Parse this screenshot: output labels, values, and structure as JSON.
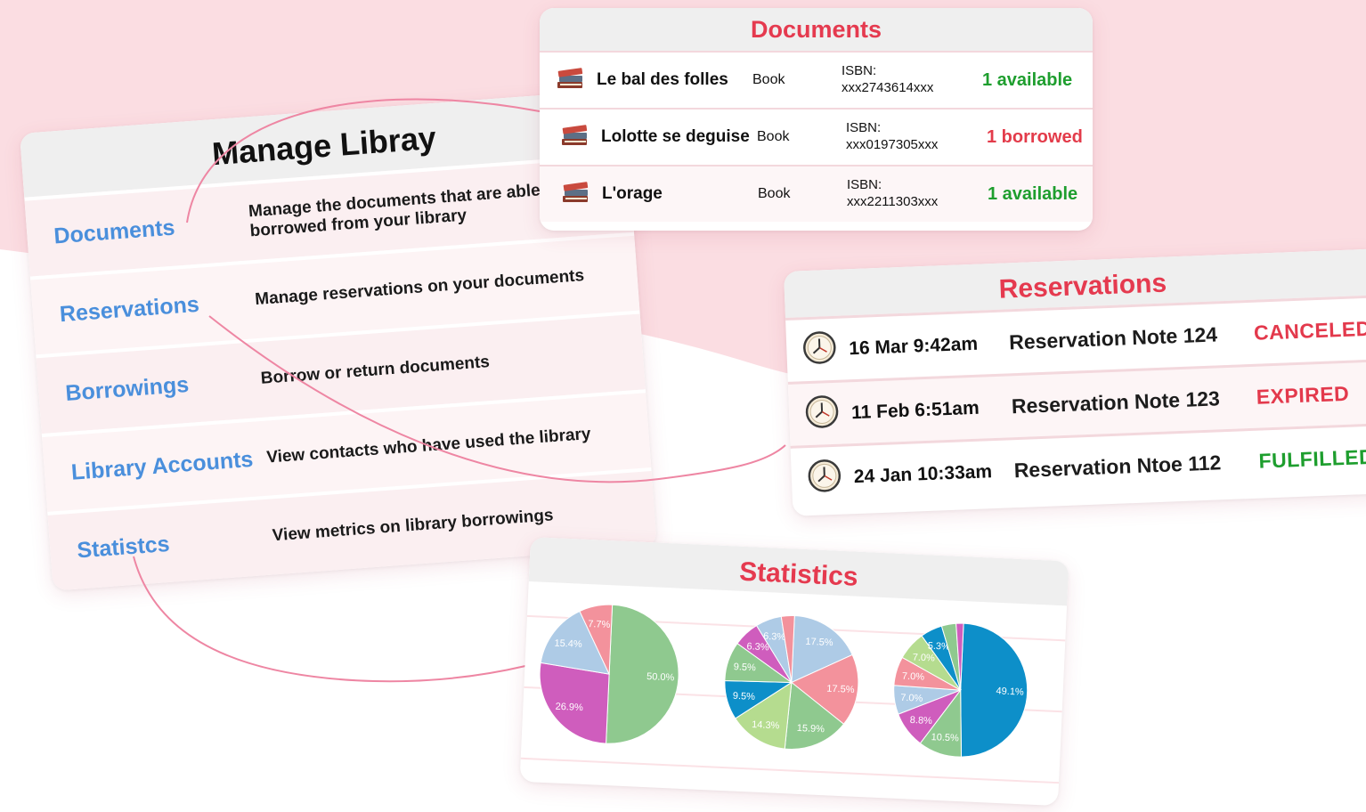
{
  "colors": {
    "accent": "#e53a4f",
    "link": "#4a8fdc",
    "ok": "#1e9e2e",
    "bad": "#e33b4a",
    "bg_blob": "#fbdde2"
  },
  "manage": {
    "title": "Manage Libray",
    "items": [
      {
        "label": "Documents",
        "desc": "Manage the documents that are able to be borrowed from your library"
      },
      {
        "label": "Reservations",
        "desc": "Manage reservations on your documents"
      },
      {
        "label": "Borrowings",
        "desc": "Borrow or return documents"
      },
      {
        "label": "Library Accounts",
        "desc": "View contacts who have used the library"
      },
      {
        "label": "Statistcs",
        "desc": "View metrics on library borrowings"
      }
    ]
  },
  "documents": {
    "title": "Documents",
    "rows": [
      {
        "icon": "books-icon",
        "title": "Le bal des folles",
        "type": "Book",
        "isbn": "ISBN:\nxxx2743614xxx",
        "status": "1 available",
        "state": "ok"
      },
      {
        "icon": "books-icon",
        "title": "Lolotte se deguise",
        "type": "Book",
        "isbn": "ISBN:\nxxx0197305xxx",
        "status": "1 borrowed",
        "state": "bad"
      },
      {
        "icon": "books-icon",
        "title": "L'orage",
        "type": "Book",
        "isbn": "ISBN:\nxxx2211303xxx",
        "status": "1 available",
        "state": "ok"
      }
    ]
  },
  "reservations": {
    "title": "Reservations",
    "rows": [
      {
        "icon": "clock-icon",
        "date": "16 Mar 9:42am",
        "note": "Reservation Note 124",
        "status": "CANCELED"
      },
      {
        "icon": "clock-icon",
        "date": "11 Feb 6:51am",
        "note": "Reservation Note 123",
        "status": "EXPIRED"
      },
      {
        "icon": "clock-icon",
        "date": "24 Jan 10:33am",
        "note": "Reservation Ntoe 112",
        "status": "FULFILLED"
      }
    ]
  },
  "statistics": {
    "title": "Statistics"
  },
  "chart_data": [
    {
      "type": "pie",
      "values": [
        50.0,
        26.9,
        15.4,
        7.7
      ],
      "labels": [
        "50.0%",
        "26.9%",
        "15.4%",
        "7.7%"
      ],
      "colors": [
        "#8fc98f",
        "#cf5dbd",
        "#aecbe6",
        "#f3929c"
      ]
    },
    {
      "type": "pie",
      "values": [
        17.5,
        17.5,
        15.9,
        14.3,
        9.5,
        9.5,
        6.3,
        6.3,
        3.2
      ],
      "labels": [
        "17.5%",
        "17.5%",
        "15.9%",
        "14.3%",
        "9.5%",
        "9.5%",
        "6.3%",
        "6.3%",
        ""
      ],
      "colors": [
        "#aecbe6",
        "#f3929c",
        "#8fc98f",
        "#b5dc8f",
        "#0d8fc9",
        "#8fc98f",
        "#cf5dbd",
        "#aecbe6",
        "#f3929c"
      ]
    },
    {
      "type": "pie",
      "values": [
        49.1,
        10.5,
        8.8,
        7.0,
        7.0,
        7.0,
        5.3,
        3.5,
        1.8
      ],
      "labels": [
        "49.1%",
        "10.5%",
        "8.8%",
        "7.0%",
        "7.0%",
        "7.0%",
        "5.3%",
        "",
        ""
      ],
      "colors": [
        "#0d8fc9",
        "#8fc98f",
        "#cf5dbd",
        "#aecbe6",
        "#f3929c",
        "#b5dc8f",
        "#0d8fc9",
        "#8fc98f",
        "#cf5dbd"
      ]
    }
  ]
}
